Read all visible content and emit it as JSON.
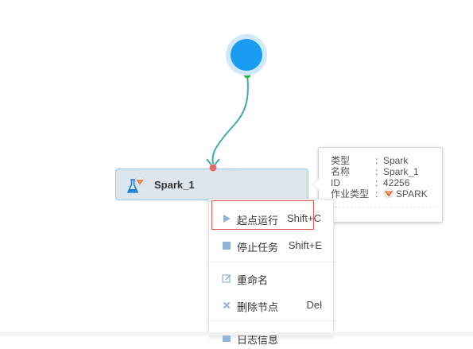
{
  "node": {
    "label": "Spark_1",
    "icon": "flask-icon",
    "badge_icon": "spark-logo-icon"
  },
  "tooltip": {
    "rows": [
      {
        "key": "类型",
        "value": "Spark"
      },
      {
        "key": "名称",
        "value": "Spark_1"
      },
      {
        "key": "ID",
        "value": "42256"
      },
      {
        "key": "作业类型",
        "value": "SPARK"
      }
    ],
    "separator": ":"
  },
  "context_menu": {
    "items": [
      {
        "label": "起点运行",
        "shortcut": "Shift+C",
        "icon": "play-icon"
      },
      {
        "label": "停止任务",
        "shortcut": "Shift+E",
        "icon": "stop-icon"
      },
      {
        "label": "重命名",
        "shortcut": "",
        "icon": "edit-icon"
      },
      {
        "label": "删除节点",
        "shortcut": "Del",
        "icon": "delete-icon"
      },
      {
        "label": "日志信息",
        "shortcut": "",
        "icon": "log-icon"
      }
    ]
  },
  "colors": {
    "start_node": "#1a9cf0",
    "edge": "#3aada8",
    "node_border": "#8fc3ea",
    "highlight": "#d9534f",
    "icon_blue": "#8fb4dc"
  }
}
